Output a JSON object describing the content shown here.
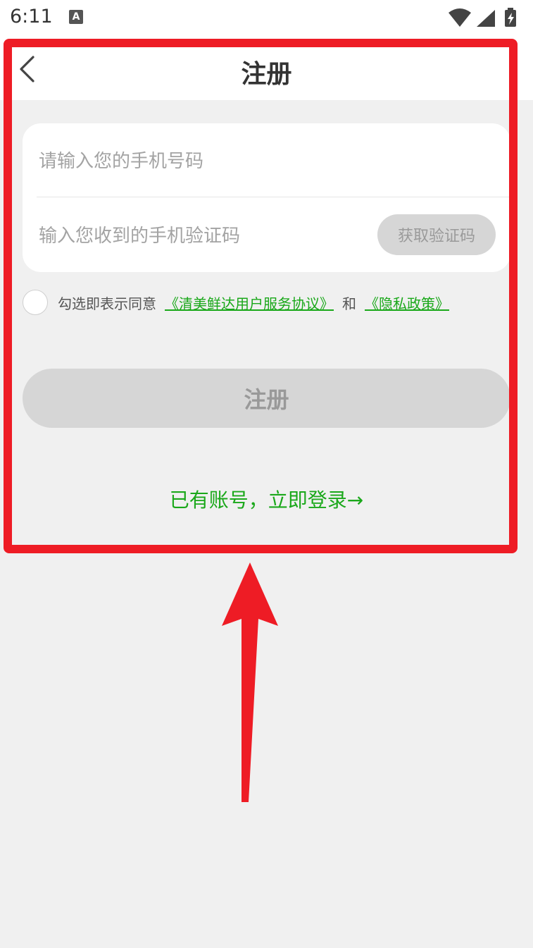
{
  "status_bar": {
    "time": "6:11",
    "notification_icon_letter": "A",
    "icons": [
      "wifi-icon",
      "signal-icon",
      "battery-charging-icon"
    ]
  },
  "header": {
    "title": "注册",
    "back_icon": "chevron-left-icon"
  },
  "form": {
    "phone_placeholder": "请输入您的手机号码",
    "phone_value": "",
    "code_placeholder": "输入您收到的手机验证码",
    "code_value": "",
    "get_code_label": "获取验证码"
  },
  "agreement": {
    "prefix": "勾选即表示同意",
    "service_link": "《清美鲜达用户服务协议》",
    "conjunction": "和",
    "privacy_link": "《隐私政策》",
    "checked": false
  },
  "register_button": {
    "label": "注册"
  },
  "login_link": {
    "label": "已有账号，立即登录→"
  },
  "colors": {
    "accent_green": "#1aa81a",
    "disabled_gray": "#d6d6d6",
    "annotation_red": "#ee1c25",
    "background": "#f0f0f0"
  }
}
